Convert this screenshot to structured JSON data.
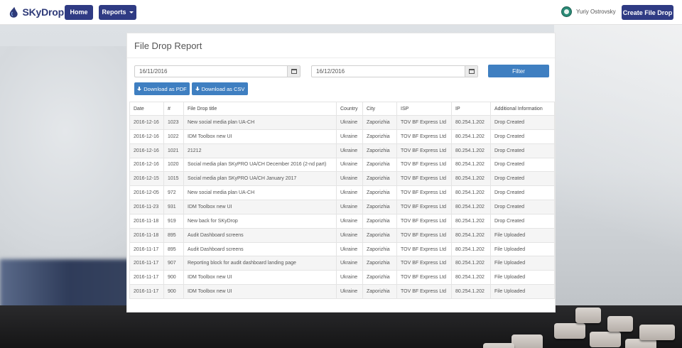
{
  "nav": {
    "brand": "SKyDrop",
    "home_label": "Home",
    "reports_label": "Reports",
    "user_name": "Yuriy Ostrovsky",
    "create_label": "Create File Drop"
  },
  "report": {
    "title": "File Drop Report",
    "date_from": "16/11/2016",
    "date_to": "16/12/2016",
    "filter_label": "Filter",
    "pdf_label": "Download as PDF",
    "csv_label": "Download as CSV",
    "columns": [
      "Date",
      "#",
      "File Drop title",
      "Country",
      "City",
      "ISP",
      "IP",
      "Additional Information"
    ],
    "rows": [
      [
        "2016-12-16",
        "1023",
        "New social media plan UA-CH",
        "Ukraine",
        "Zaporizhia",
        "TOV BF Express Ltd",
        "80.254.1.202",
        "Drop Created"
      ],
      [
        "2016-12-16",
        "1022",
        "IDM Toolbox new UI",
        "Ukraine",
        "Zaporizhia",
        "TOV BF Express Ltd",
        "80.254.1.202",
        "Drop Created"
      ],
      [
        "2016-12-16",
        "1021",
        "21212",
        "Ukraine",
        "Zaporizhia",
        "TOV BF Express Ltd",
        "80.254.1.202",
        "Drop Created"
      ],
      [
        "2016-12-16",
        "1020",
        "Social media plan SKyPRO UA/CH December 2016 (2-nd part)",
        "Ukraine",
        "Zaporizhia",
        "TOV BF Express Ltd",
        "80.254.1.202",
        "Drop Created"
      ],
      [
        "2016-12-15",
        "1015",
        "Social media plan SKyPRO UA/CH January 2017",
        "Ukraine",
        "Zaporizhia",
        "TOV BF Express Ltd",
        "80.254.1.202",
        "Drop Created"
      ],
      [
        "2016-12-05",
        "972",
        "New social media plan UA-CH",
        "Ukraine",
        "Zaporizhia",
        "TOV BF Express Ltd",
        "80.254.1.202",
        "Drop Created"
      ],
      [
        "2016-11-23",
        "931",
        "IDM Toolbox new UI",
        "Ukraine",
        "Zaporizhia",
        "TOV BF Express Ltd",
        "80.254.1.202",
        "Drop Created"
      ],
      [
        "2016-11-18",
        "919",
        "New back for SKyDrop",
        "Ukraine",
        "Zaporizhia",
        "TOV BF Express Ltd",
        "80.254.1.202",
        "Drop Created"
      ],
      [
        "2016-11-18",
        "895",
        "Audit Dashboard screens",
        "Ukraine",
        "Zaporizhia",
        "TOV BF Express Ltd",
        "80.254.1.202",
        "File Uploaded"
      ],
      [
        "2016-11-17",
        "895",
        "Audit Dashboard screens",
        "Ukraine",
        "Zaporizhia",
        "TOV BF Express Ltd",
        "80.254.1.202",
        "File Uploaded"
      ],
      [
        "2016-11-17",
        "907",
        "Reporting block for audit dashboard landing page",
        "Ukraine",
        "Zaporizhia",
        "TOV BF Express Ltd",
        "80.254.1.202",
        "File Uploaded"
      ],
      [
        "2016-11-17",
        "900",
        "IDM Toolbox new UI",
        "Ukraine",
        "Zaporizhia",
        "TOV BF Express Ltd",
        "80.254.1.202",
        "File Uploaded"
      ],
      [
        "2016-11-17",
        "900",
        "IDM Toolbox new UI",
        "Ukraine",
        "Zaporizhia",
        "TOV BF Express Ltd",
        "80.254.1.202",
        "File Uploaded"
      ]
    ]
  },
  "colors": {
    "nav_button": "#2f3b84",
    "primary_button": "#3f7fc1",
    "brand_text": "#2e3a78"
  },
  "icons": {
    "logo": "skydrop-logo-icon",
    "avatar": "user-avatar-icon",
    "calendar": "calendar-icon",
    "download": "download-icon",
    "caret": "caret-down-icon"
  }
}
